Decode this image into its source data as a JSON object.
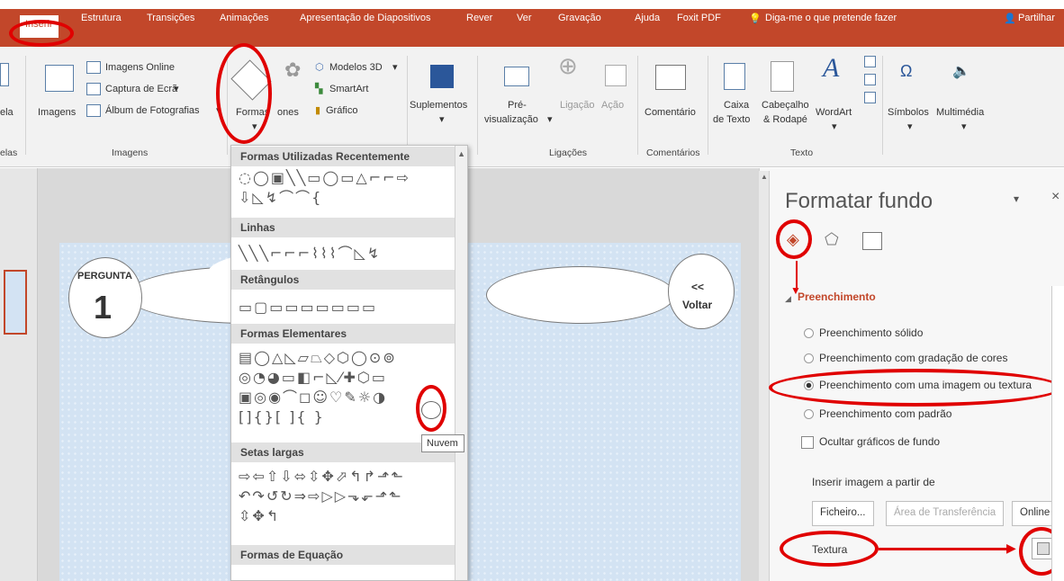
{
  "tabs": {
    "inserir": "Inserir",
    "estrutura": "Estrutura",
    "transicoes": "Transições",
    "animacoes": "Animações",
    "apresentacao": "Apresentação de Diapositivos",
    "rever": "Rever",
    "ver": "Ver",
    "gravacao": "Gravação",
    "ajuda": "Ajuda",
    "foxit": "Foxit PDF",
    "tell": "Diga-me o que pretende fazer",
    "share": "Partilhar"
  },
  "ribbon": {
    "tabela_partial": "ela",
    "tabelas_partial": "elas",
    "imagens": "Imagens",
    "imagens_online": "Imagens Online",
    "captura": "Captura de Ecrã",
    "album": "Álbum de Fotografias",
    "imagens_group": "Imagens",
    "formas": "Formas",
    "icones_partial": "ones",
    "modelos3d": "Modelos 3D",
    "smartart": "SmartArt",
    "grafico": "Gráfico",
    "suplementos": "Suplementos",
    "pre": "Pré-",
    "visualizacao": "visualização",
    "ligacao": "Ligação",
    "acao": "Ação",
    "ligacoes_group": "Ligações",
    "comentario": "Comentário",
    "comentarios_group": "Comentários",
    "caixa": "Caixa",
    "de_texto": "de Texto",
    "cabecalho": "Cabeçalho",
    "rodape": "& Rodapé",
    "wordart": "WordArt",
    "texto_group": "Texto",
    "simbolos": "Símbolos",
    "multimedia": "Multimédia"
  },
  "dropdown": {
    "recent_header": "Formas Utilizadas Recentemente",
    "recent_row1": "◌◯▣╲╲▭◯▭△⌐⌐⇨",
    "recent_row2": "⇩◺↯⌒⌒{",
    "lines_header": "Linhas",
    "lines_row": "╲╲╲⌐⌐⌐⌇⌇⌇⌒◺↯",
    "rect_header": "Retângulos",
    "rect_row": "▭▢▭▭▭▭▭▭▭",
    "basic_header": "Formas Elementares",
    "basic_row1": "▤◯△◺▱⏢◇⬡◯⊙⊚",
    "basic_row2": "◎◔◕▭◧⌐◺⁄✚⬡▭",
    "basic_row3": "▣◎◉⌒◻☺♡✎☼◑",
    "basic_row4": "[]{}[ ]{ }",
    "tooltip": "Nuvem",
    "arrows_header": "Setas largas",
    "arrows_row1": "⇨⇦⇧⇩⬄⇳✥⬀↰↱⬏⬑",
    "arrows_row2": "↶↷↺↻⇒⇨▷▷⬎⬐⬏⬑",
    "arrows_row3": "⇳✥↰",
    "equation_header": "Formas de Equação"
  },
  "slide": {
    "pergunta": "PERGUNTA",
    "numero": "1",
    "voltar_arrows": "<<",
    "voltar": "Voltar"
  },
  "pane": {
    "title": "Formatar fundo",
    "section": "Preenchimento",
    "solid": "Preenchimento sólido",
    "gradient": "Preenchimento com gradação de cores",
    "picture": "Preenchimento com uma imagem ou textura",
    "pattern": "Preenchimento com padrão",
    "hide": "Ocultar gráficos de fundo",
    "insert_from": "Inserir imagem a partir de",
    "ficheiro": "Ficheiro...",
    "area": "Área de Transferência",
    "online": "Online",
    "textura": "Textura"
  },
  "colors": {
    "accent": "#c2472a",
    "highlight_ring": "#e00000"
  }
}
